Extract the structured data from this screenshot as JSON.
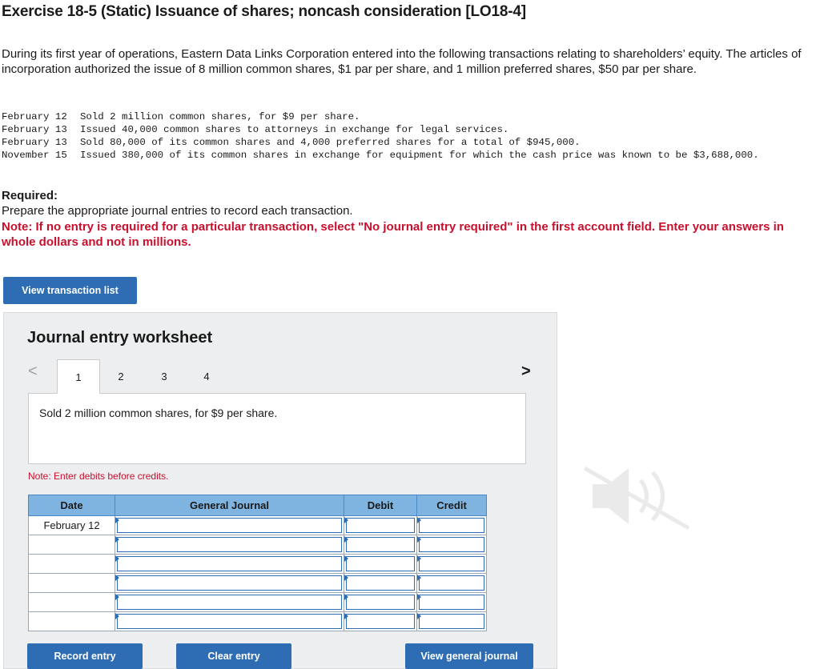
{
  "header": {
    "title": "Exercise 18-5 (Static) Issuance of shares; noncash consideration [LO18-4]"
  },
  "intro": "During its first year of operations, Eastern Data Links Corporation entered into the following transactions relating to shareholders’ equity. The articles of incorporation authorized the issue of 8 million common shares, $1 par per share, and 1 million preferred shares, $50 par per share.",
  "transactions": [
    {
      "date": "February 12",
      "text": "Sold 2 million common shares, for $9 per share."
    },
    {
      "date": "February 13",
      "text": "Issued 40,000 common shares to attorneys in exchange for legal services."
    },
    {
      "date": "February 13",
      "text": "Sold 80,000 of its common shares and 4,000 preferred shares for a total of $945,000."
    },
    {
      "date": "November 15",
      "text": "Issued 380,000 of its common shares in exchange for equipment for which the cash price was known to be $3,688,000."
    }
  ],
  "required": {
    "heading": "Required:",
    "instruction": "Prepare the appropriate journal entries to record each transaction.",
    "note": "Note: If no entry is required for a particular transaction, select \"No journal entry required\" in the first account field. Enter your answers in whole dollars and not in millions."
  },
  "buttons": {
    "view_transactions": "View transaction list",
    "record_entry": "Record entry",
    "clear_entry": "Clear entry",
    "view_general_journal": "View general journal"
  },
  "worksheet": {
    "title": "Journal entry worksheet",
    "prev_icon": "<",
    "next_icon": ">",
    "tabs": [
      "1",
      "2",
      "3",
      "4"
    ],
    "active_tab": "1",
    "description": "Sold 2 million common shares, for $9 per share.",
    "note": "Note: Enter debits before credits.",
    "columns": [
      "Date",
      "General Journal",
      "Debit",
      "Credit"
    ],
    "rows": [
      {
        "date": "February 12",
        "account": "",
        "debit": "",
        "credit": ""
      },
      {
        "date": "",
        "account": "",
        "debit": "",
        "credit": ""
      },
      {
        "date": "",
        "account": "",
        "debit": "",
        "credit": ""
      },
      {
        "date": "",
        "account": "",
        "debit": "",
        "credit": ""
      },
      {
        "date": "",
        "account": "",
        "debit": "",
        "credit": ""
      },
      {
        "date": "",
        "account": "",
        "debit": "",
        "credit": ""
      }
    ]
  },
  "colors": {
    "accent": "#2e6db4",
    "header_fill": "#7fb3e0",
    "note_red": "#c8102e",
    "panel_bg": "#eceeef"
  }
}
